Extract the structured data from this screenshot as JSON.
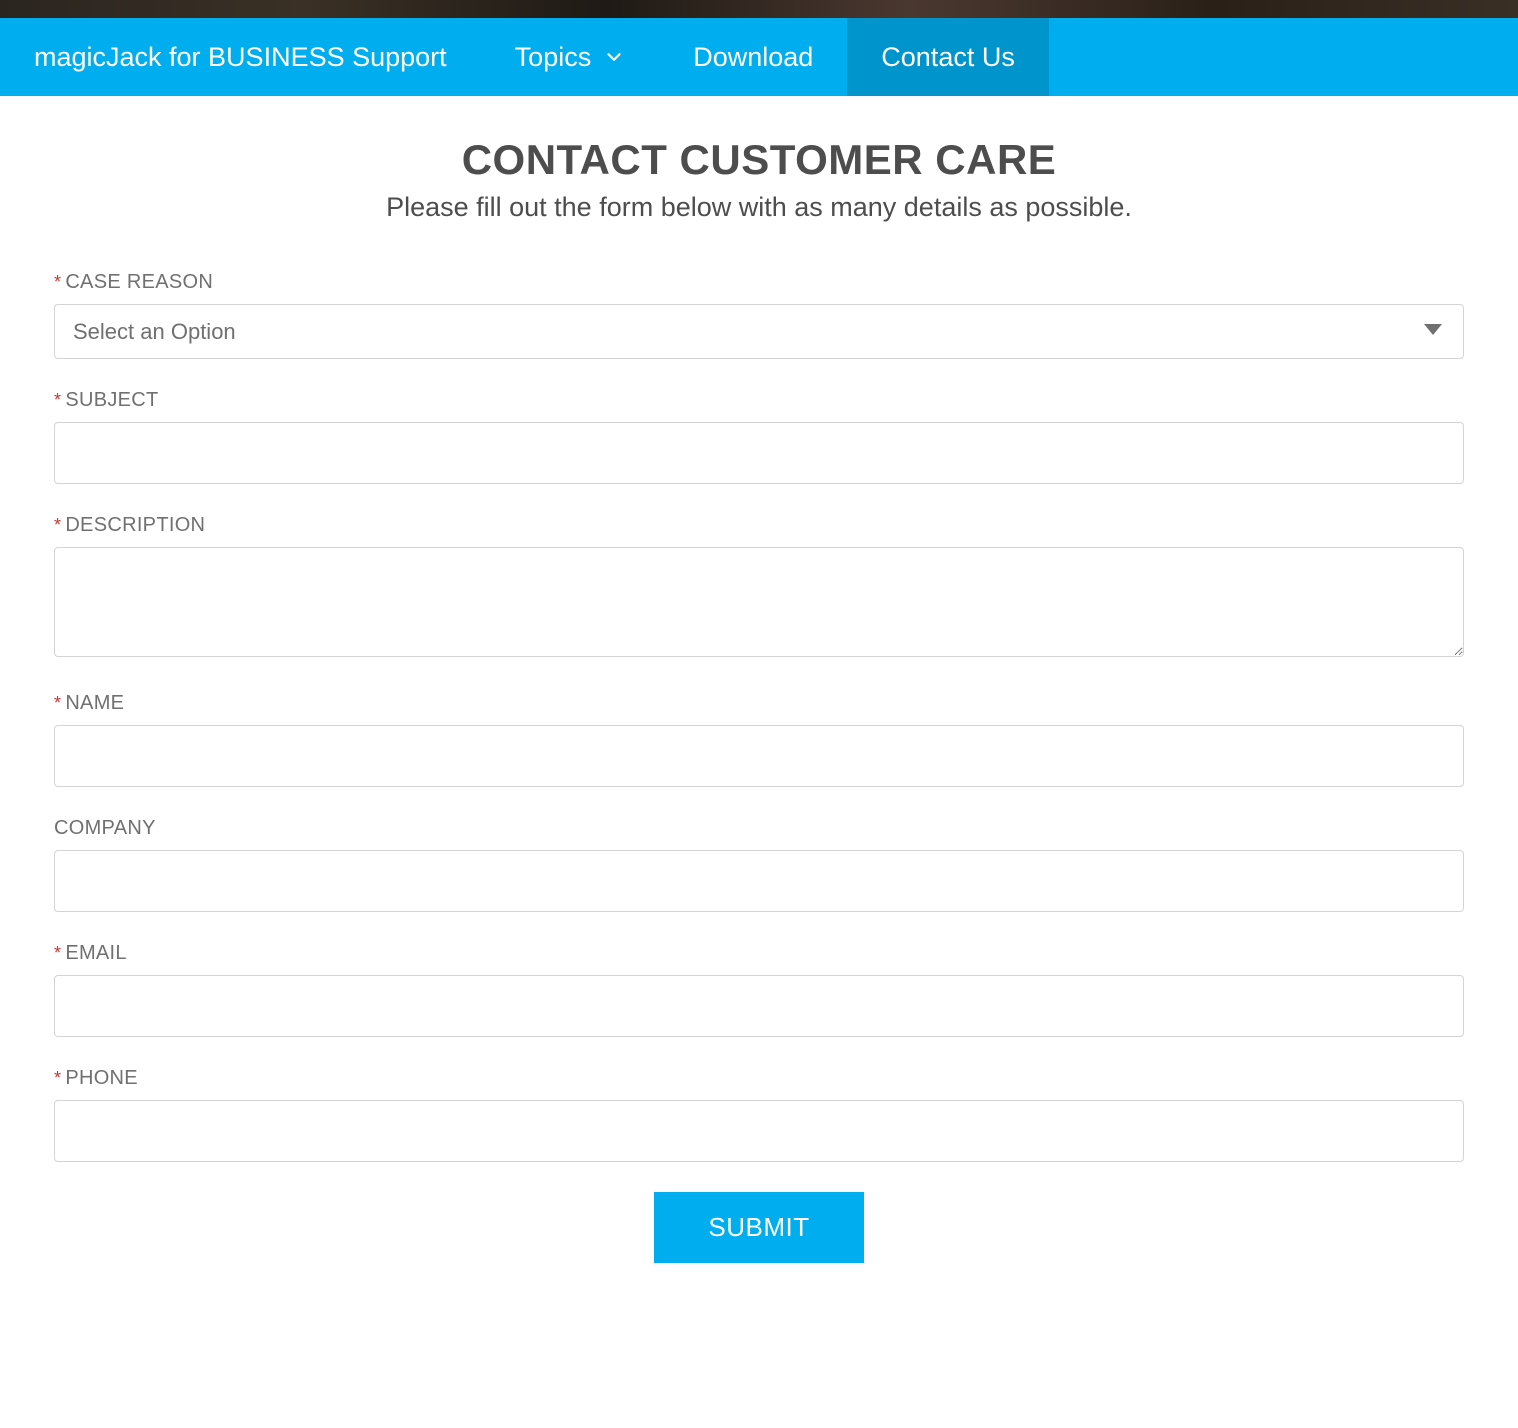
{
  "nav": {
    "brand": "magicJack for BUSINESS Support",
    "items": [
      {
        "label": "Topics",
        "hasDropdown": true,
        "active": false
      },
      {
        "label": "Download",
        "hasDropdown": false,
        "active": false
      },
      {
        "label": "Contact Us",
        "hasDropdown": false,
        "active": true
      }
    ]
  },
  "page": {
    "title": "CONTACT CUSTOMER CARE",
    "subtitle": "Please fill out the form below with as many details as possible."
  },
  "form": {
    "caseReason": {
      "label": "CASE REASON",
      "required": true,
      "placeholder": "Select an Option",
      "value": ""
    },
    "subject": {
      "label": "SUBJECT",
      "required": true,
      "value": ""
    },
    "description": {
      "label": "DESCRIPTION",
      "required": true,
      "value": ""
    },
    "name": {
      "label": "NAME",
      "required": true,
      "value": ""
    },
    "company": {
      "label": "COMPANY",
      "required": false,
      "value": ""
    },
    "email": {
      "label": "EMAIL",
      "required": true,
      "value": ""
    },
    "phone": {
      "label": "PHONE",
      "required": true,
      "value": ""
    },
    "submitLabel": "SUBMIT"
  },
  "colors": {
    "primary": "#00aeef",
    "primaryDark": "#0094cc",
    "textMuted": "#707070",
    "textHeading": "#4d4d4d",
    "border": "#d4d4d4",
    "required": "#c23934"
  }
}
